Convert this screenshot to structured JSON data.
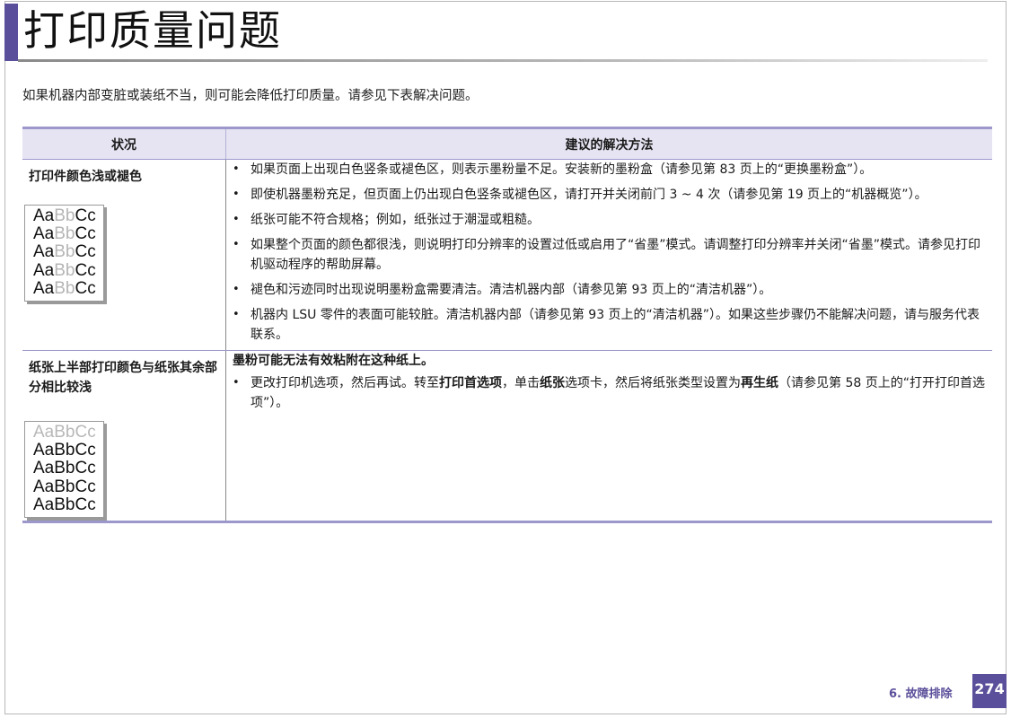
{
  "page": {
    "title": "打印质量问题",
    "intro": "如果机器内部变脏或装纸不当，则可能会降低打印质量。请参见下表解决问题。"
  },
  "table": {
    "headers": {
      "condition": "状况",
      "solution": "建议的解决方法"
    },
    "rows": [
      {
        "condition": "打印件颜色浅或褪色",
        "sample_text": [
          "Aa",
          "Bb",
          "Cc"
        ],
        "bullets": [
          "如果页面上出现白色竖条或褪色区，则表示墨粉量不足。安装新的墨粉盒（请参见第 83 页上的“更换墨粉盒”）。",
          "即使机器墨粉充足，但页面上仍出现白色竖条或褪色区，请打开并关闭前门 3 ~ 4 次（请参见第 19 页上的“机器概览”）。",
          "纸张可能不符合规格；例如，纸张过于潮湿或粗糙。",
          "如果整个页面的颜色都很浅，则说明打印分辨率的设置过低或启用了“省墨”模式。请调整打印分辨率并关闭“省墨”模式。请参见打印机驱动程序的帮助屏幕。",
          "褪色和污迹同时出现说明墨粉盒需要清洁。清洁机器内部（请参见第 93 页上的“清洁机器”）。",
          "机器内 LSU 零件的表面可能较脏。清洁机器内部（请参见第 93 页上的“清洁机器”）。如果这些步骤仍不能解决问题，请与服务代表联系。"
        ]
      },
      {
        "condition": "纸张上半部打印颜色与纸张其余部分相比较浅",
        "sample_text": "AaBbCc",
        "solution_title": "墨粉可能无法有效粘附在这种纸上。",
        "bullet": {
          "part1": "更改打印机选项，然后再试。转至",
          "bold1": "打印首选项",
          "part2": "，单击",
          "bold2": "纸张",
          "part3": "选项卡，然后将纸张类型设置为",
          "bold3": "再生纸",
          "part4": "（请参见第 58 页上的“打开打印首选项”）。"
        }
      }
    ]
  },
  "footer": {
    "chapter": "6.  故障排除",
    "page_number": "274"
  },
  "colors": {
    "accent": "#5a4f9a",
    "header_bg": "#e6e4f2",
    "table_rule": "#9c98cc"
  }
}
